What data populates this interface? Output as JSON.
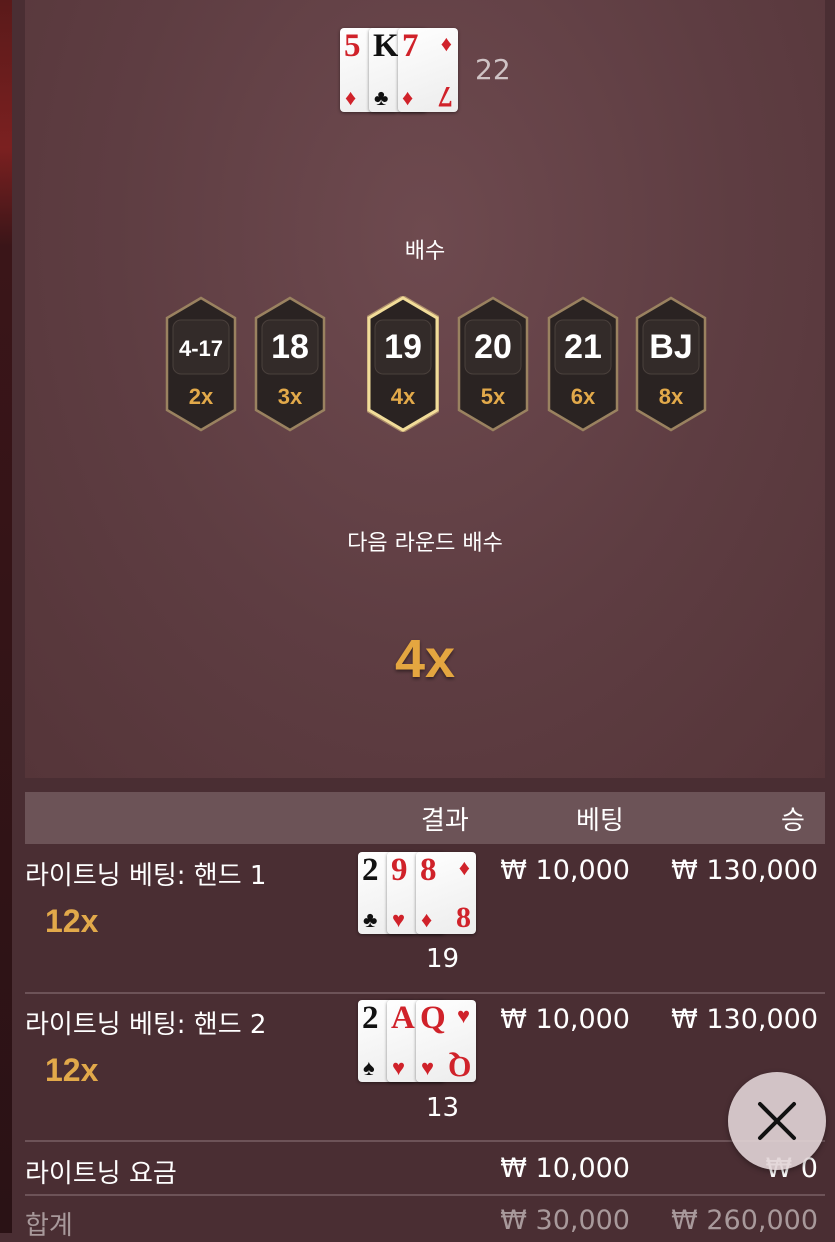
{
  "dealer": {
    "cards": [
      {
        "rank": "5",
        "suit": "♦",
        "color": "red"
      },
      {
        "rank": "K",
        "suit": "♣",
        "color": "black"
      },
      {
        "rank": "7",
        "suit": "♦",
        "color": "red"
      }
    ],
    "total": "22"
  },
  "multipliers": {
    "title": "배수",
    "items": [
      {
        "value": "4-17",
        "mult": "2x"
      },
      {
        "value": "18",
        "mult": "3x"
      },
      {
        "value": "19",
        "mult": "4x",
        "highlighted": true
      },
      {
        "value": "20",
        "mult": "5x"
      },
      {
        "value": "21",
        "mult": "6x"
      },
      {
        "value": "BJ",
        "mult": "8x"
      }
    ]
  },
  "next_round": {
    "title": "다음 라운드 배수",
    "value": "4x"
  },
  "table": {
    "headers": {
      "result": "결과",
      "bet": "베팅",
      "win": "승"
    },
    "rows": [
      {
        "label": "라이트닝 베팅: 핸드 1",
        "mult": "12x",
        "total": "19",
        "bet": "₩ 10,000",
        "win": "₩ 130,000",
        "cards": [
          {
            "rank": "2",
            "suit": "♣",
            "color": "black"
          },
          {
            "rank": "9",
            "suit": "♥",
            "color": "red"
          },
          {
            "rank": "8",
            "suit": "♦",
            "color": "red"
          }
        ]
      },
      {
        "label": "라이트닝 베팅: 핸드 2",
        "mult": "12x",
        "total": "13",
        "bet": "₩ 10,000",
        "win": "₩ 130,000",
        "cards": [
          {
            "rank": "2",
            "suit": "♠",
            "color": "black"
          },
          {
            "rank": "A",
            "suit": "♥",
            "color": "red"
          },
          {
            "rank": "Q",
            "suit": "♥",
            "color": "red"
          }
        ]
      },
      {
        "label": "라이트닝 요금",
        "bet": "₩ 10,000",
        "win": "₩ 0"
      },
      {
        "label": "합계",
        "bet": "₩ 30,000",
        "win": "₩ 260,000"
      }
    ]
  },
  "close_icon": "close-x-icon",
  "colors": {
    "accent_gold": "#e2a94a",
    "panel": "#5e3d42",
    "background": "#4a2e33"
  }
}
